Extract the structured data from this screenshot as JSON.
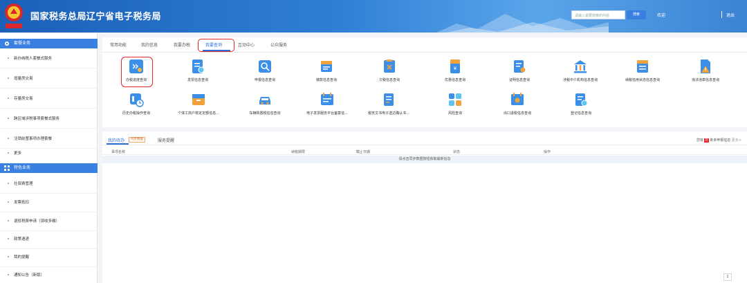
{
  "header": {
    "title": "国家税务总局辽宁省电子税务局",
    "search_placeholder": "请输入需要搜索的内容",
    "search_button": "搜索",
    "welcome": "欢迎",
    "logout": "退出"
  },
  "sidebar": {
    "section1": "套餐业务",
    "items1": [
      "新办纳税人套餐式服务",
      "增量房交易",
      "存量房交易",
      "跨区域涉税事项套餐式服务",
      "注销前置事项办理套餐",
      "更多"
    ],
    "section2": "特色业务",
    "items2": [
      "社保费管理",
      "发票抵扣",
      "退抵税费申请（误收多缴）",
      "政策速递",
      "我的提醒",
      "通知公告（新版）"
    ]
  },
  "tabs": [
    "常用功能",
    "我的信息",
    "我要办税",
    "我要查询",
    "互动中心",
    "公众服务"
  ],
  "functions": [
    "办税进度查询",
    "发票信息查询",
    "申报信息查询",
    "缴款信息查询",
    "欠税信息查询",
    "优惠信息查询",
    "证明信息查询",
    "涉税中介机构信息查询",
    "纳税信用状态信息查询",
    "违法违章信息查询",
    "历史办税操作查询",
    "个体工商户核定定额信息...",
    "车辆购置税信息查询",
    "电子发票服务平台备案信...",
    "税务文书电子送达确认书...",
    "风险查询",
    "出口退税信息查询",
    "登记信息查询"
  ],
  "todo": {
    "tab1": "我的待办",
    "sync": "同步数据",
    "tab2": "服务提醒",
    "notice_prefix": "您有",
    "notice_count": "0",
    "notice_suffix": "条未申报信息",
    "more": "更多>",
    "columns": [
      "事项名称",
      "纳税期限",
      "截止日期",
      "状态",
      "操作"
    ],
    "empty": "请点击同步数据按钮获取最新信息"
  },
  "pagination": {
    "current": "1"
  },
  "colors": {
    "primary": "#3a80e0",
    "highlight": "#e3292b"
  }
}
